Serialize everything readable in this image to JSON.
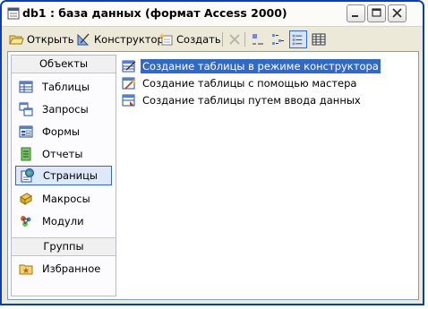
{
  "window": {
    "title": "db1 : база данных (формат Access 2000)"
  },
  "toolbar": {
    "open_label": "Открыть",
    "design_label": "Конструктор",
    "new_label": "Создать"
  },
  "sidebar": {
    "objects_header": "Объекты",
    "groups_header": "Группы",
    "items": [
      {
        "label": "Таблицы",
        "icon": "tables-icon"
      },
      {
        "label": "Запросы",
        "icon": "queries-icon"
      },
      {
        "label": "Формы",
        "icon": "forms-icon"
      },
      {
        "label": "Отчеты",
        "icon": "reports-icon"
      },
      {
        "label": "Страницы",
        "icon": "pages-icon"
      },
      {
        "label": "Макросы",
        "icon": "macros-icon"
      },
      {
        "label": "Модули",
        "icon": "modules-icon"
      }
    ],
    "selected_item": "Страницы",
    "groups": [
      {
        "label": "Избранное",
        "icon": "favorites-icon"
      }
    ]
  },
  "objects_list": {
    "items": [
      {
        "label": "Создание таблицы в режиме конструктора",
        "icon": "design-view-icon",
        "selected": true
      },
      {
        "label": "Создание таблицы с помощью мастера",
        "icon": "wizard-icon",
        "selected": false
      },
      {
        "label": "Создание таблицы путем ввода данных",
        "icon": "datasheet-icon",
        "selected": false
      }
    ]
  },
  "colors": {
    "window_border": "#0a3fb0",
    "selection": "#316ac5",
    "face": "#ece9d8"
  }
}
